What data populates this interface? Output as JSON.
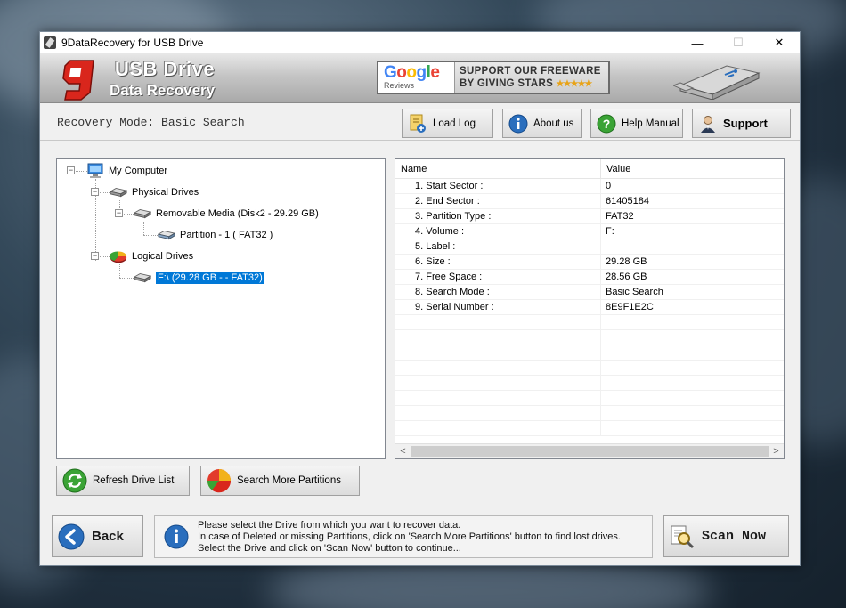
{
  "window": {
    "title": "9DataRecovery for USB Drive",
    "controls": {
      "minimize": "—",
      "maximize": "☐",
      "close": "✕"
    }
  },
  "banner": {
    "brand_line1": "USB Drive",
    "brand_line2": "Data Recovery",
    "google_word": "Google",
    "google_reviews": "Reviews",
    "promo_line1": "SUPPORT OUR FREEWARE",
    "promo_line2": "BY GIVING STARS",
    "stars": "★★★★★"
  },
  "modebar": {
    "recovery_mode": "Recovery Mode: Basic Search",
    "buttons": {
      "load_log": "Load Log",
      "about_us": "About us",
      "help_manual": "Help Manual",
      "support": "Support"
    }
  },
  "tree": {
    "my_computer": "My Computer",
    "physical_drives": "Physical Drives",
    "removable_media": "Removable Media (Disk2 - 29.29 GB)",
    "partition": "Partition - 1 ( FAT32 )",
    "logical_drives": "Logical Drives",
    "logical_drive_f": "F:\\ (29.28 GB -  - FAT32)"
  },
  "grid": {
    "columns": [
      "Name",
      "Value"
    ],
    "rows": [
      {
        "name": "1. Start Sector :",
        "value": "0"
      },
      {
        "name": "2. End Sector :",
        "value": "61405184"
      },
      {
        "name": "3. Partition Type :",
        "value": "FAT32"
      },
      {
        "name": "4. Volume :",
        "value": "F:"
      },
      {
        "name": "5. Label :",
        "value": ""
      },
      {
        "name": "6. Size :",
        "value": "29.28 GB"
      },
      {
        "name": "7. Free Space :",
        "value": "28.56 GB"
      },
      {
        "name": "8. Search Mode :",
        "value": "Basic Search"
      },
      {
        "name": "9. Serial Number :",
        "value": "8E9F1E2C"
      }
    ],
    "scroll_left": "<",
    "scroll_right": ">"
  },
  "actions": {
    "refresh": "Refresh Drive List",
    "search_more": "Search More Partitions"
  },
  "footer": {
    "back": "Back",
    "scan_now": "Scan Now",
    "info_line1": "Please select the Drive from which you want to recover data.",
    "info_line2": "In case of Deleted or missing Partitions, click on 'Search More Partitions' button to find lost drives.",
    "info_line3": "Select the Drive and click on 'Scan Now' button to continue..."
  },
  "colors": {
    "selection": "#0078d7",
    "logo_red": "#d9261c",
    "info_blue": "#2a6ebd",
    "help_green": "#3aa335"
  }
}
